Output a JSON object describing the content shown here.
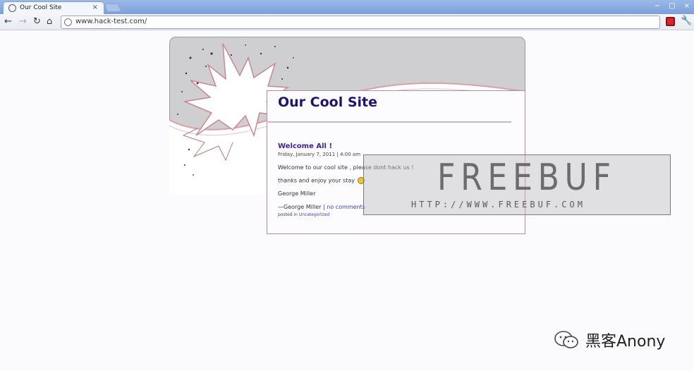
{
  "browser": {
    "tab_title": "Our Cool Site",
    "tab_close": "×",
    "url": "www.hack-test.com/",
    "nav": {
      "back": "←",
      "forward": "→",
      "reload": "↻",
      "home": "⌂"
    },
    "window_buttons": {
      "minimize": "−",
      "maximize": "□",
      "close": "×"
    },
    "wrench": "🔧"
  },
  "page": {
    "site_title": "Our Cool Site",
    "post": {
      "title": "Welcome All !",
      "date": "Friday, January 7, 2011 | 4:00 am",
      "line1": "Welcome to our cool site , please dont hack us !",
      "line2": "thanks and enjoy your stay",
      "signature": "George Miller",
      "meta_author": "—George Miller | ",
      "meta_comments": "no comments",
      "category_prefix": "posted in ",
      "category": "Uncategorized"
    }
  },
  "watermark": {
    "big": "FREEBUF",
    "small": "HTTP://WWW.FREEBUF.COM",
    "corner": "黑客Anony"
  },
  "colors": {
    "title": "#24126f",
    "post_title": "#3d1f99",
    "link": "#3d3fc0",
    "header_bg": "#cfcfd2",
    "accent_line": "#c0868f"
  }
}
